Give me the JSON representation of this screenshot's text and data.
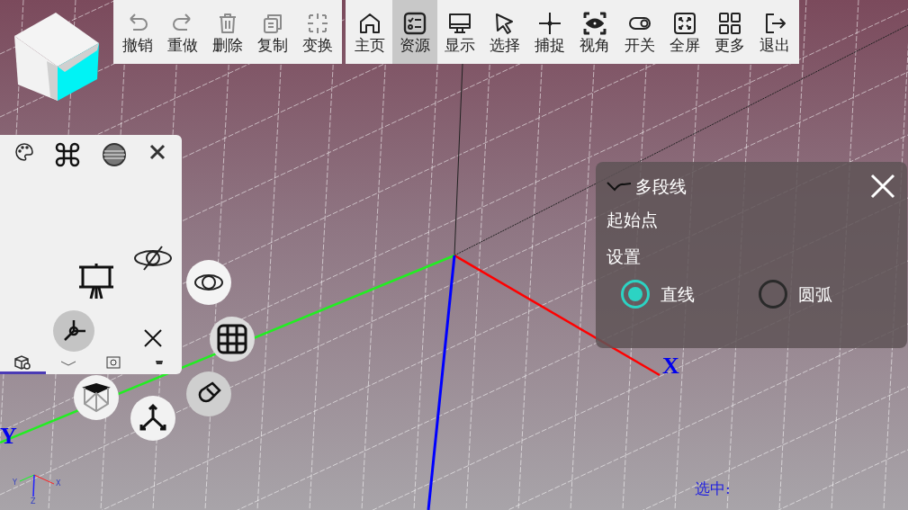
{
  "toolbar": {
    "groups": [
      {
        "items": [
          {
            "kind": "undo",
            "label": "撤销",
            "disabled": true,
            "selected": false
          },
          {
            "kind": "redo",
            "label": "重做",
            "disabled": true,
            "selected": false
          },
          {
            "kind": "trash",
            "label": "删除",
            "disabled": true,
            "selected": false
          },
          {
            "kind": "copy",
            "label": "复制",
            "disabled": true,
            "selected": false
          },
          {
            "kind": "transform",
            "label": "变换",
            "disabled": true,
            "selected": false
          }
        ]
      },
      {
        "items": [
          {
            "kind": "home",
            "label": "主页",
            "disabled": false,
            "selected": false
          },
          {
            "kind": "list",
            "label": "资源",
            "disabled": false,
            "selected": true
          },
          {
            "kind": "monitor",
            "label": "显示",
            "disabled": false,
            "selected": false
          },
          {
            "kind": "cursor",
            "label": "选择",
            "disabled": false,
            "selected": false
          },
          {
            "kind": "cross",
            "label": "捕捉",
            "disabled": false,
            "selected": false
          },
          {
            "kind": "eye",
            "label": "视角",
            "disabled": false,
            "selected": false
          },
          {
            "kind": "toggle",
            "label": "开关",
            "disabled": false,
            "selected": false
          },
          {
            "kind": "fullscreen",
            "label": "全屏",
            "disabled": false,
            "selected": false
          },
          {
            "kind": "grid",
            "label": "更多",
            "disabled": false,
            "selected": false
          },
          {
            "kind": "exit",
            "label": "退出",
            "disabled": false,
            "selected": false
          }
        ]
      }
    ]
  },
  "resource_panel": {
    "tabs": [
      {
        "kind": "cube",
        "selected": true
      },
      {
        "kind": "layers",
        "selected": false
      },
      {
        "kind": "camera",
        "selected": false
      },
      {
        "kind": "cart",
        "selected": false
      }
    ]
  },
  "viewport": {
    "axis_labels": [
      "X",
      "Y"
    ],
    "mini_axis_labels": [
      "Y",
      "X",
      "Z"
    ],
    "status": "选中:"
  },
  "command_panel": {
    "title": "多段线",
    "prompt": "起始点",
    "settings_label": "设置",
    "options": [
      {
        "label": "直线",
        "selected": true
      },
      {
        "label": "圆弧",
        "selected": false
      }
    ]
  }
}
